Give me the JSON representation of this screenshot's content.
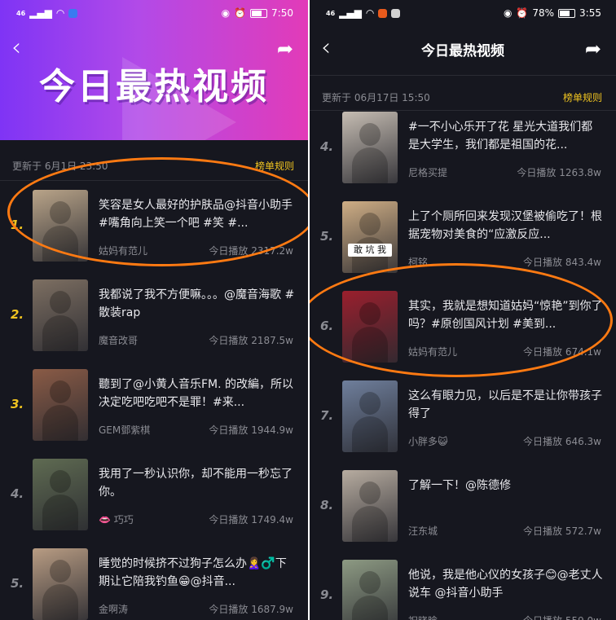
{
  "left": {
    "status": {
      "network": "46",
      "time": "7:50"
    },
    "header": {
      "title": "今日最热视频",
      "update_text": "更新于 6月1日 23:50",
      "rules_label": "榜单规则"
    },
    "items": [
      {
        "rank": "1.",
        "title": "笑容是女人最好的护肤品@抖音小助手 #嘴角向上笑一个吧 #笑 #...",
        "author": "姑妈有范儿",
        "plays": "今日播放 2317.2w",
        "thumb_color": "#b9a489"
      },
      {
        "rank": "2.",
        "title": "我都说了我不方便嘛。。。@魔音海歌 #散装rap",
        "author": "魔音改哥",
        "plays": "今日播放 2187.5w",
        "thumb_color": "#7d6f62"
      },
      {
        "rank": "3.",
        "title": "聽到了@小黄人音乐FM. 的改編，所以决定吃吧吃吧不是罪！#来...",
        "author": "GEM鄧紫棋",
        "plays": "今日播放 1944.9w",
        "thumb_color": "#8a5b46"
      },
      {
        "rank": "4.",
        "title": "我用了一秒认识你，却不能用一秒忘了你。",
        "author": "👄 巧巧",
        "plays": "今日播放 1749.4w",
        "thumb_color": "#5f6b52"
      },
      {
        "rank": "5.",
        "title": "睡觉的时候挤不过狗子怎么办🙎‍♀️♂️下期让它陪我钓鱼😁@抖音...",
        "author": "金啊涛",
        "plays": "今日播放 1687.9w",
        "thumb_color": "#b89c83"
      }
    ]
  },
  "right": {
    "status": {
      "network": "46",
      "battery": "78%",
      "time": "3:55"
    },
    "header": {
      "title": "今日最热视频",
      "update_text": "更新于 06月17日 15:50",
      "rules_label": "榜单规则"
    },
    "items": [
      {
        "rank": "4.",
        "title": "#一不小心乐开了花 星光大道我们都是大学生，我们都是祖国的花...",
        "author": "尼格买提",
        "plays": "今日播放 1263.8w",
        "thumb_color": "#c6bdb3"
      },
      {
        "rank": "5.",
        "title": "上了个厕所回来发现汉堡被偷吃了！根据宠物对美食的“应激反应...",
        "author": "柯铭",
        "plays": "今日播放 843.4w",
        "thumb_color": "#cfae85",
        "thumb_caption": "敢 坑 我"
      },
      {
        "rank": "6.",
        "title": "其实，我就是想知道姑妈“惊艳”到你了吗？#原创国风计划 #美到...",
        "author": "姑妈有范儿",
        "plays": "今日播放 674.1w",
        "thumb_color": "#9a1f2d"
      },
      {
        "rank": "7.",
        "title": "这么有眼力见，以后是不是让你带孩子得了",
        "author": "小胖多😺",
        "plays": "今日播放 646.3w",
        "thumb_color": "#6f7f9c"
      },
      {
        "rank": "8.",
        "title": "了解一下！@陈德修",
        "author": "汪东城",
        "plays": "今日播放 572.7w",
        "thumb_color": "#b7aca0"
      },
      {
        "rank": "9.",
        "title": "他说，我是他心仪的女孩子😊@老丈人说车 @抖音小助手",
        "author": "祝晓晗",
        "plays": "今日播放 559.0w",
        "thumb_color": "#8d9a83"
      }
    ]
  }
}
